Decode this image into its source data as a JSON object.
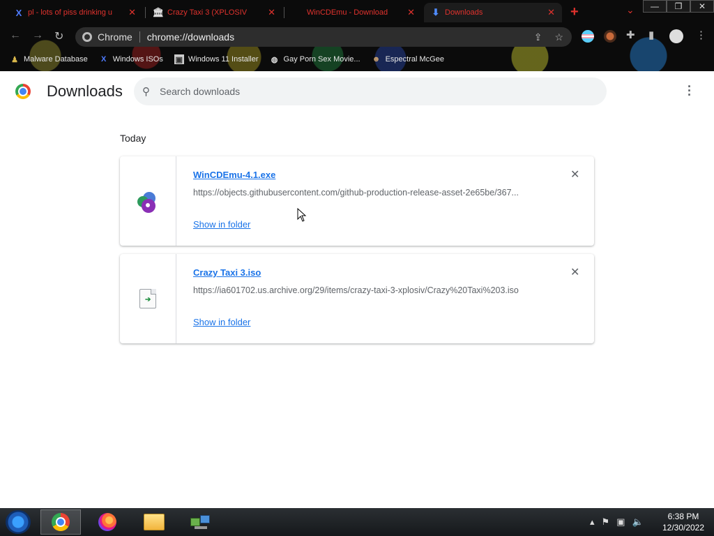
{
  "browser": {
    "tabs": [
      {
        "icon": "x-logo-icon",
        "title": "pl - lots of piss drinking u",
        "active": false
      },
      {
        "icon": "institution-icon",
        "title": "Crazy Taxi 3 (XPLOSIV",
        "active": false
      },
      {
        "icon": "wincdemu-icon",
        "title": "WinCDEmu - Download",
        "active": false
      },
      {
        "icon": "download-icon",
        "title": "Downloads",
        "active": true
      }
    ],
    "omnibox": {
      "chip_label": "Chrome",
      "url": "chrome://downloads"
    },
    "bookmarks": [
      {
        "icon": "bug-icon",
        "label": "Malware Database"
      },
      {
        "icon": "x-logo-icon",
        "label": "Windows ISOs"
      },
      {
        "icon": "picture-icon",
        "label": "Windows 11 Installer"
      },
      {
        "icon": "globe-icon",
        "label": "Gay Porn Sex Movie..."
      },
      {
        "icon": "avatar-icon",
        "label": "Espectral McGee"
      }
    ]
  },
  "downloads": {
    "title": "Downloads",
    "search_placeholder": "Search downloads",
    "section_label": "Today",
    "items": [
      {
        "file_name": "WinCDEmu-4.1.exe",
        "url": "https://objects.githubusercontent.com/github-production-release-asset-2e65be/367...",
        "action_label": "Show in folder"
      },
      {
        "file_name": "Crazy Taxi 3.iso",
        "url": "https://ia601702.us.archive.org/29/items/crazy-taxi-3-xplosiv/Crazy%20Taxi%203.iso",
        "action_label": "Show in folder"
      }
    ]
  },
  "taskbar": {
    "time": "6:38 PM",
    "date": "12/30/2022"
  },
  "colors": {
    "accent_link": "#1a73e8",
    "tab_text": "#e0322d",
    "chrome_bg": "#0b0b0b",
    "taskbar_bg": "#1f2326"
  }
}
